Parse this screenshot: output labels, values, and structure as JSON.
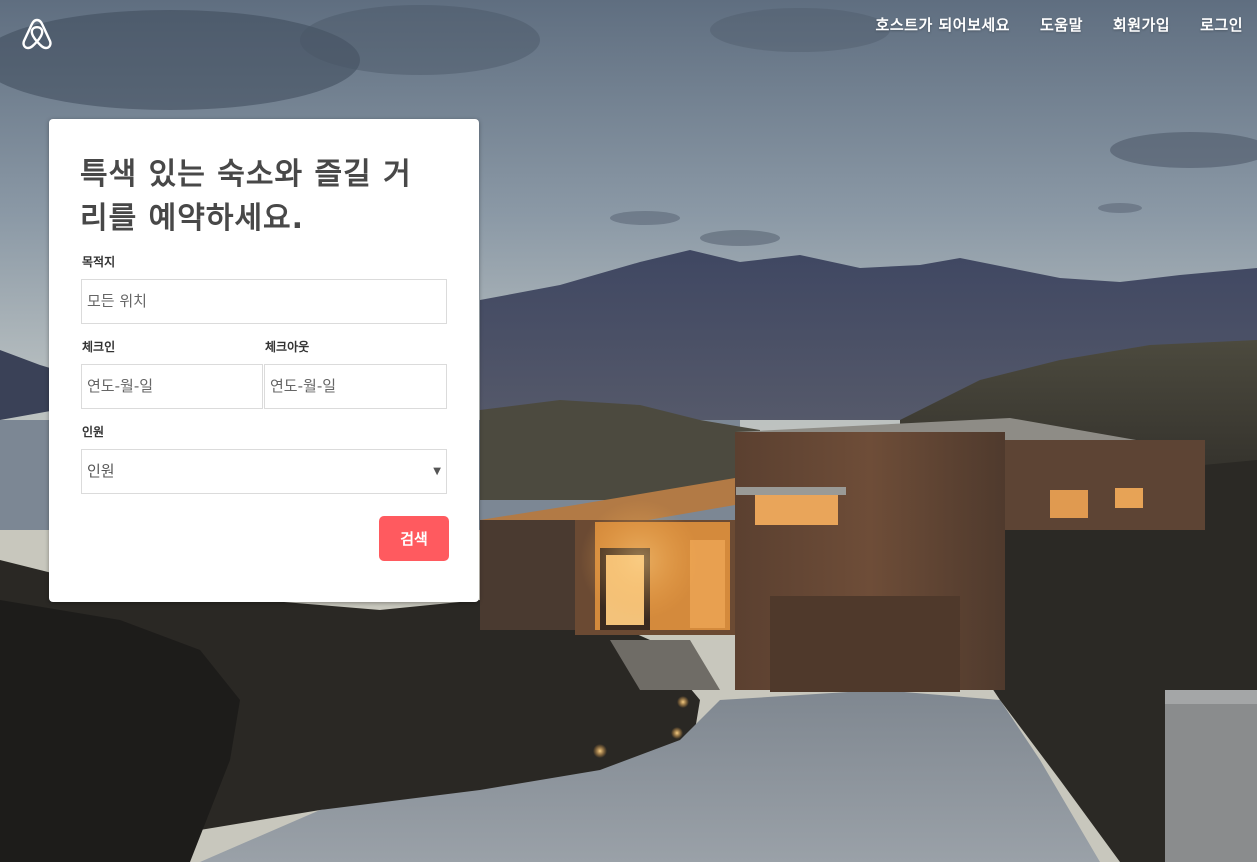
{
  "colors": {
    "accent": "#ff5a5f",
    "title": "#484848"
  },
  "header": {
    "logo_icon": "airbnb-belo-icon",
    "nav": [
      {
        "label": "호스트가 되어보세요"
      },
      {
        "label": "도움말"
      },
      {
        "label": "회원가입"
      },
      {
        "label": "로그인"
      }
    ]
  },
  "search_card": {
    "title": "특색 있는 숙소와 즐길 거리를 예약하세요.",
    "destination": {
      "label": "목적지",
      "placeholder": "모든 위치"
    },
    "checkin": {
      "label": "체크인",
      "placeholder": "연도-월-일"
    },
    "checkout": {
      "label": "체크아웃",
      "placeholder": "연도-월-일"
    },
    "guests": {
      "label": "인원",
      "selected": "인원",
      "arrow_icon": "triangle-down-icon"
    },
    "search_button": "검색"
  }
}
